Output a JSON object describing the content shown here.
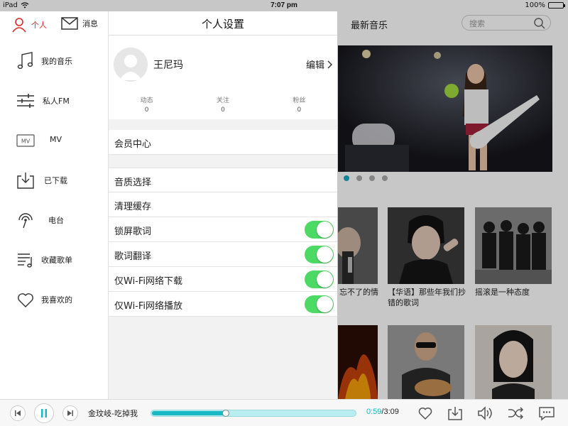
{
  "statusbar": {
    "device": "iPad",
    "time": "7:07 pm",
    "battery": "100%",
    "battery_level": 1.0
  },
  "main": {
    "title": "最新音乐",
    "search_placeholder": "搜索",
    "banner_dots": 4,
    "banner_active": 0,
    "tiles": [
      {
        "caption": "忘不了的情"
      },
      {
        "caption": "【华语】那些年我们抄错的歌词"
      },
      {
        "caption": "摇滚是一种态度"
      }
    ]
  },
  "sidebar": {
    "tabs": [
      {
        "label": "个人",
        "icon": "person-icon",
        "color": "#e02828"
      },
      {
        "label": "消息",
        "icon": "mail-icon"
      }
    ],
    "items": [
      {
        "label": "我的音乐",
        "icon": "music-note-icon"
      },
      {
        "label": "私人FM",
        "icon": "equalizer-icon"
      },
      {
        "label": "MV",
        "icon": "mv-icon"
      },
      {
        "label": "已下载",
        "icon": "download-icon"
      },
      {
        "label": "电台",
        "icon": "radio-icon"
      },
      {
        "label": "收藏歌单",
        "icon": "playlist-icon"
      },
      {
        "label": "我喜欢的",
        "icon": "heart-icon"
      }
    ]
  },
  "settings": {
    "title": "个人设置",
    "username": "王尼玛",
    "edit_label": "编辑",
    "stats": [
      {
        "label": "动态",
        "value": "0"
      },
      {
        "label": "关注",
        "value": "0"
      },
      {
        "label": "粉丝",
        "value": "0"
      }
    ],
    "member_center": "会员中心",
    "rows": [
      {
        "label": "音质选择"
      },
      {
        "label": "清理缓存"
      }
    ],
    "toggles": [
      {
        "label": "锁屏歌词",
        "on": true
      },
      {
        "label": "歌词翻译",
        "on": true
      },
      {
        "label": "仅Wi-Fi网络下载",
        "on": true
      },
      {
        "label": "仅Wi-Fi网络播放",
        "on": true
      }
    ],
    "toggle_color": "#4cd964"
  },
  "player": {
    "song": "金玟岐-吃掉我",
    "elapsed": "0:59",
    "duration": "/3:09",
    "progress": 0.36,
    "accent": "#19b8c4"
  }
}
